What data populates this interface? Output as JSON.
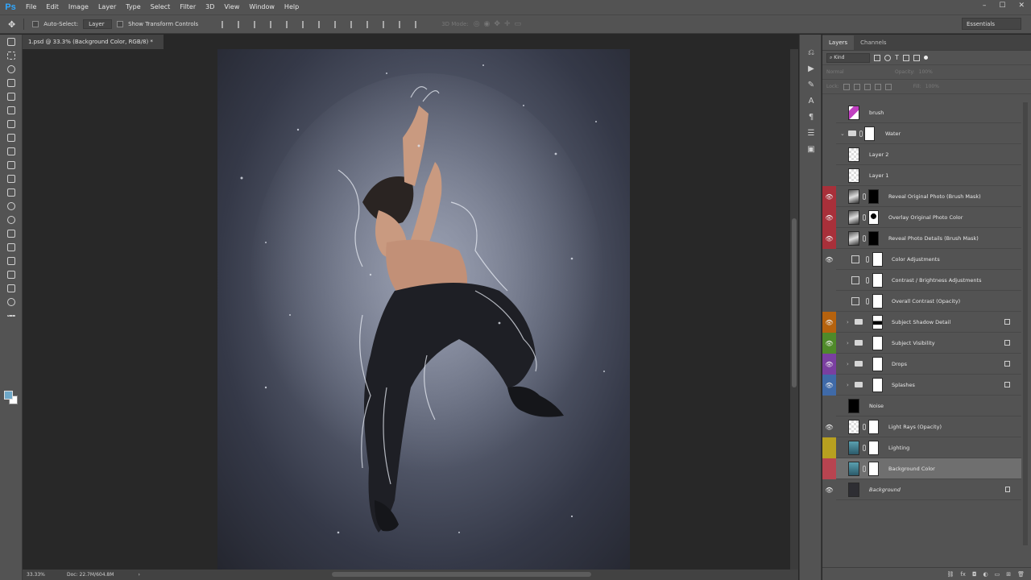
{
  "app": {
    "logo": "Ps"
  },
  "menu": [
    "File",
    "Edit",
    "Image",
    "Layer",
    "Type",
    "Select",
    "Filter",
    "3D",
    "View",
    "Window",
    "Help"
  ],
  "window_controls": [
    "–",
    "☐",
    "✕"
  ],
  "options": {
    "auto_select_label": "Auto-Select:",
    "auto_select_value": "Layer",
    "transform_label": "Show Transform Controls",
    "mode_label": "3D Mode:",
    "workspace": "Essentials"
  },
  "document": {
    "tab_title": "1.psd @ 33.3% (Background Color, RGB/8) *",
    "tab_close": "×",
    "zoom": "33.33%",
    "doc_info": "Doc: 22.7M/604.8M"
  },
  "panel": {
    "tabs": [
      "Layers",
      "Channels"
    ],
    "kind_label": "Kind",
    "blend_mode": "Normal",
    "opacity_label": "Opacity:",
    "opacity_value": "100%",
    "lock_label": "Lock:",
    "fill_label": "Fill:",
    "fill_value": "100%"
  },
  "layers": [
    {
      "name": "brush",
      "vis": false,
      "color": "#535353",
      "type": "img"
    },
    {
      "name": "Water",
      "vis": false,
      "color": "#535353",
      "type": "group-mask"
    },
    {
      "name": "Layer 2",
      "vis": false,
      "color": "#535353",
      "type": "transparent"
    },
    {
      "name": "Layer 1",
      "vis": false,
      "color": "#535353",
      "type": "transparent"
    },
    {
      "name": "Reveal Original Photo (Brush Mask)",
      "vis": true,
      "color": "#a8303a",
      "type": "photo-blackmask"
    },
    {
      "name": "Overlay Original Photo Color",
      "vis": true,
      "color": "#a8303a",
      "type": "photo-mask"
    },
    {
      "name": "Reveal Photo Details (Brush Mask)",
      "vis": true,
      "color": "#a8303a",
      "type": "photo-blackmask"
    },
    {
      "name": "Color Adjustments",
      "vis": true,
      "color": "#535353",
      "type": "adj"
    },
    {
      "name": "Contrast / Brightness Adjustments",
      "vis": false,
      "color": "#535353",
      "type": "adj"
    },
    {
      "name": "Overall Contrast (Opacity)",
      "vis": false,
      "color": "#535353",
      "type": "adj"
    },
    {
      "name": "Subject Shadow Detail",
      "vis": true,
      "color": "#b5620e",
      "type": "group"
    },
    {
      "name": "Subject Visibility",
      "vis": true,
      "color": "#4f8a2a",
      "type": "group"
    },
    {
      "name": "Drops",
      "vis": true,
      "color": "#7a3fa0",
      "type": "group"
    },
    {
      "name": "Splashes",
      "vis": true,
      "color": "#3f6aa8",
      "type": "group"
    },
    {
      "name": "Noise",
      "vis": false,
      "color": "#535353",
      "type": "black"
    },
    {
      "name": "Light Rays (Opacity)",
      "vis": true,
      "color": "#535353",
      "type": "transparent-mask"
    },
    {
      "name": "Lighting",
      "vis": false,
      "color": "#b8a020",
      "type": "teal-mask"
    },
    {
      "name": "Background Color",
      "vis": false,
      "color": "#b84450",
      "type": "teal-mask",
      "selected": true
    },
    {
      "name": "Background",
      "vis": true,
      "color": "#535353",
      "type": "bg"
    }
  ]
}
